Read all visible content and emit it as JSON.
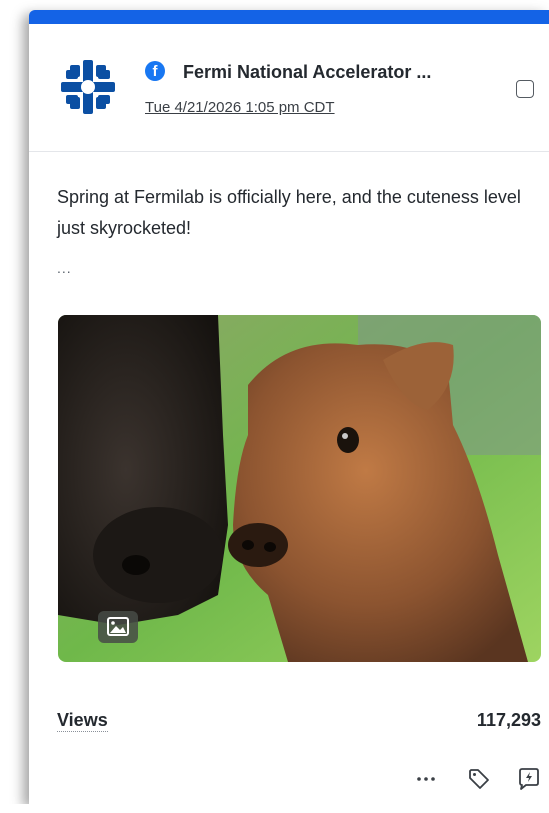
{
  "post": {
    "platform_icon": "facebook-icon",
    "author": "Fermi National Accelerator ...",
    "timestamp": "Tue 4/21/2026 1:05 pm CDT",
    "text": "Spring at Fermilab is officially here, and the cuteness level just skyrocketed!",
    "more_indicator": "...",
    "image_alt": "bison calf photo"
  },
  "stats": {
    "views_label": "Views",
    "views_value": "117,293"
  },
  "actions": [
    "more-icon",
    "tag-icon",
    "boost-icon"
  ],
  "colors": {
    "accent_bar": "#1463e6",
    "logo": "#0b4fa3",
    "facebook": "#1877f2"
  }
}
